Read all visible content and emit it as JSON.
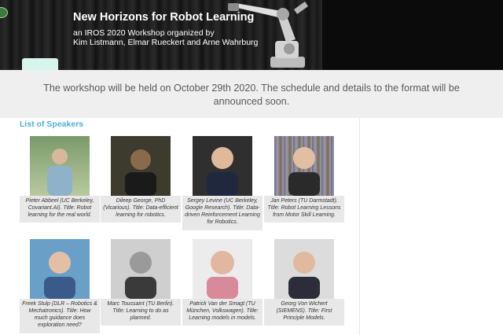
{
  "banner": {
    "title": "New Horizons for Robot Learning",
    "subtitle_line1": "an IROS 2020 Workshop organized by",
    "subtitle_line2": "Kim Listmann, Elmar Rueckert and Arne Wahrburg"
  },
  "announcement": "The workshop will be held on October 29th 2020. The schedule and details to the format will be announced soon.",
  "speakers_heading": "List of Speakers",
  "speakers": [
    {
      "caption": "Pieter Abbeel (UC Berkeley, Covariant.AI). Title: Robot learning for the real world."
    },
    {
      "caption": "Dileep George, PhD (Vicarious). Title: Data-efficient learning for robotics."
    },
    {
      "caption": "Sergey Levine (UC Berkeley, Google Research). Title: Data-driven Reinforcement Learning for Robotics."
    },
    {
      "caption": "Jan Peters (TU Darmstadt). Title: Robot Learning Lessons from Motor Skill Learning."
    },
    {
      "caption": "Freek Stulp (DLR – Robotics & Mechatronics). Title: How much guidance does exploration need?"
    },
    {
      "caption": "Marc Toussaint (TU Berlin). Title: Learning to do as planned."
    },
    {
      "caption": "Patrick Van der Smagt (TU München, Volkswagen). Title: Learning models in models."
    },
    {
      "caption": "Georg Von Wichert (SIEMENS). Title: First Principle Models."
    }
  ]
}
